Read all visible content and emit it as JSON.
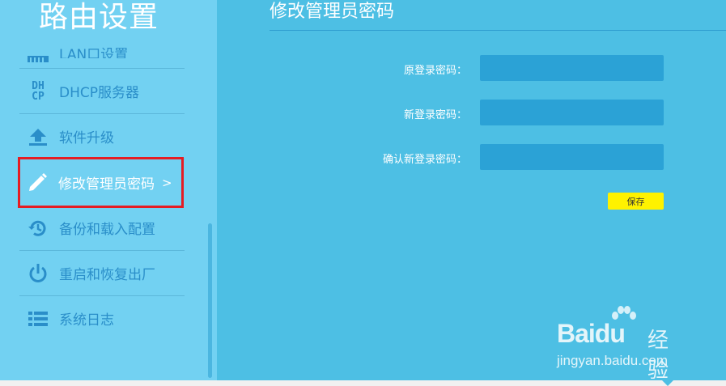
{
  "sidebar": {
    "title": "路由设置",
    "partial_item": "LAN口设置",
    "items": [
      {
        "label": "DHCP服务器",
        "icon": "dhcp-icon"
      },
      {
        "label": "软件升级",
        "icon": "upload-icon"
      },
      {
        "label": "修改管理员密码",
        "icon": "pencil-icon",
        "active": true,
        "arrow": ">"
      },
      {
        "label": "备份和载入配置",
        "icon": "history-icon"
      },
      {
        "label": "重启和恢复出厂",
        "icon": "power-icon"
      },
      {
        "label": "系统日志",
        "icon": "list-icon"
      }
    ],
    "dhcp_icon_text": [
      "DH",
      "CP"
    ]
  },
  "main": {
    "title": "修改管理员密码",
    "fields": [
      {
        "label": "原登录密码：",
        "value": ""
      },
      {
        "label": "新登录密码：",
        "value": ""
      },
      {
        "label": "确认新登录密码：",
        "value": ""
      }
    ],
    "save_label": "保存"
  },
  "watermark": {
    "brand": "Baidu",
    "suffix": "经验",
    "url": "jingyan.baidu.com"
  },
  "colors": {
    "sidebar_bg": "#72d1f2",
    "main_bg": "#4dbfe4",
    "input_bg": "#2ba2d6",
    "save_bg": "#fff200",
    "highlight": "#e51c23",
    "nav_text": "#2a8ec9"
  }
}
